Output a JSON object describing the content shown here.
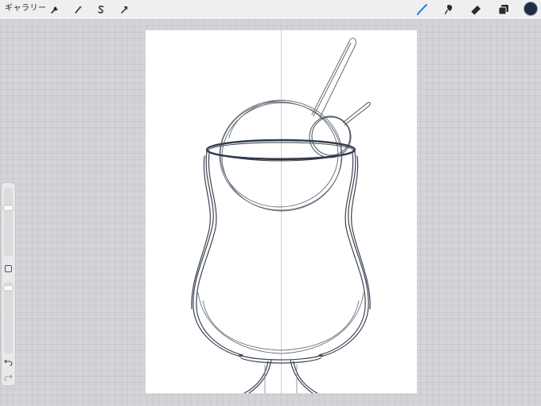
{
  "toolbar": {
    "gallery_label": "ギャラリー",
    "left_tools": [
      "wrench-icon",
      "magic-wand-icon",
      "selection-icon",
      "transform-arrow-icon"
    ],
    "right_tools": [
      "brush-icon",
      "smudge-icon",
      "eraser-icon",
      "layers-icon"
    ],
    "active_tool": "brush",
    "active_tool_color": "#2e7bd6",
    "current_color": "#1d2d44"
  },
  "sidebar": {
    "brush_size": 0.27,
    "opacity": 0.06,
    "controls": [
      "brush-size-slider",
      "modify-button",
      "opacity-slider",
      "undo-icon",
      "redo-icon"
    ]
  },
  "canvas": {
    "background": "#ffffff",
    "stroke_color": "#3a4350",
    "guide": "vertical-symmetry-guide"
  }
}
